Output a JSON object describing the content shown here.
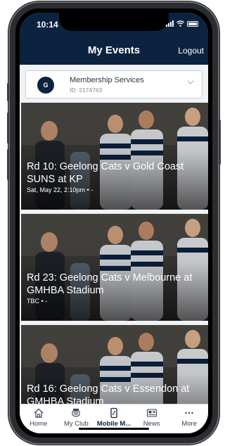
{
  "status_bar": {
    "time": "10:14"
  },
  "header": {
    "title": "My Events",
    "logout_label": "Logout"
  },
  "account": {
    "avatar_letter": "G",
    "name": "Membership Services",
    "id_text": "ID: 2174763"
  },
  "events": [
    {
      "title": "Rd 10: Geelong Cats v Gold Coast SUNS at KP",
      "meta": "Sat, May 22, 2:10pm • -"
    },
    {
      "title": "Rd 23: Geelong Cats v Melbourne at GMHBA Stadium",
      "meta": "TBC • -"
    },
    {
      "title": "Rd 16: Geelong Cats v Essendon at GMHBA Stadium",
      "meta": ""
    }
  ],
  "tab_bar": {
    "items": [
      {
        "label": "Home",
        "icon": "home-icon"
      },
      {
        "label": "My Club",
        "icon": "club-crest-icon"
      },
      {
        "label": "Mobile M...",
        "icon": "mobile-ticket-icon"
      },
      {
        "label": "News",
        "icon": "news-icon"
      },
      {
        "label": "More",
        "icon": "more-dots-icon"
      }
    ],
    "active_index": 2
  },
  "colors": {
    "navy": "#0c2340",
    "background": "#f1f2f4"
  }
}
